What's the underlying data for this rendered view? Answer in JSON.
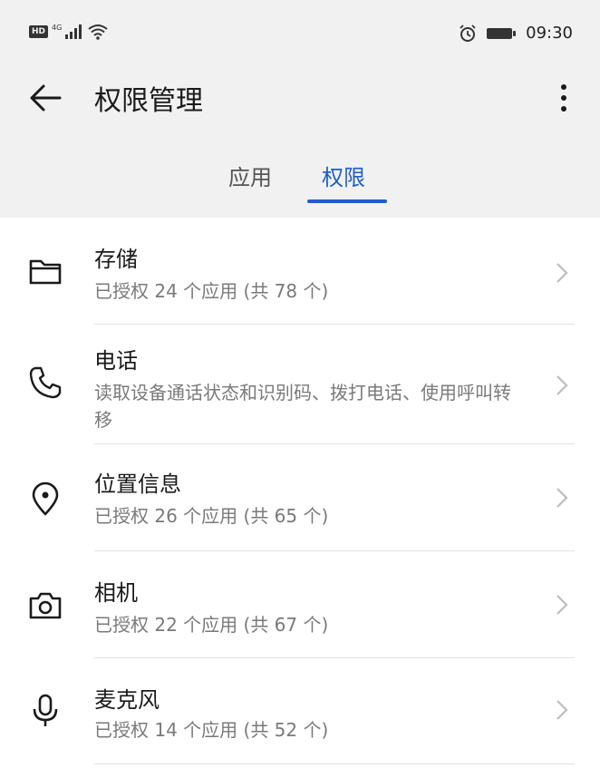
{
  "status": {
    "hd": "HD",
    "network": "4G",
    "time": "09:30"
  },
  "header": {
    "title": "权限管理"
  },
  "tabs": [
    {
      "label": "应用",
      "active": false
    },
    {
      "label": "权限",
      "active": true
    }
  ],
  "colors": {
    "accent": "#1f5fc9",
    "header_bg": "#f1f1f1"
  },
  "permissions": [
    {
      "name": "存储",
      "desc": "已授权 24 个应用 (共 78 个)",
      "icon": "folder-icon"
    },
    {
      "name": "电话",
      "desc": "读取设备通话状态和识别码、拨打电话、使用呼叫转移",
      "icon": "phone-icon"
    },
    {
      "name": "位置信息",
      "desc": "已授权 26 个应用 (共 65 个)",
      "icon": "location-pin-icon"
    },
    {
      "name": "相机",
      "desc": "已授权 22 个应用 (共 67 个)",
      "icon": "camera-icon"
    },
    {
      "name": "麦克风",
      "desc": "已授权 14 个应用 (共 52 个)",
      "icon": "microphone-icon"
    }
  ]
}
